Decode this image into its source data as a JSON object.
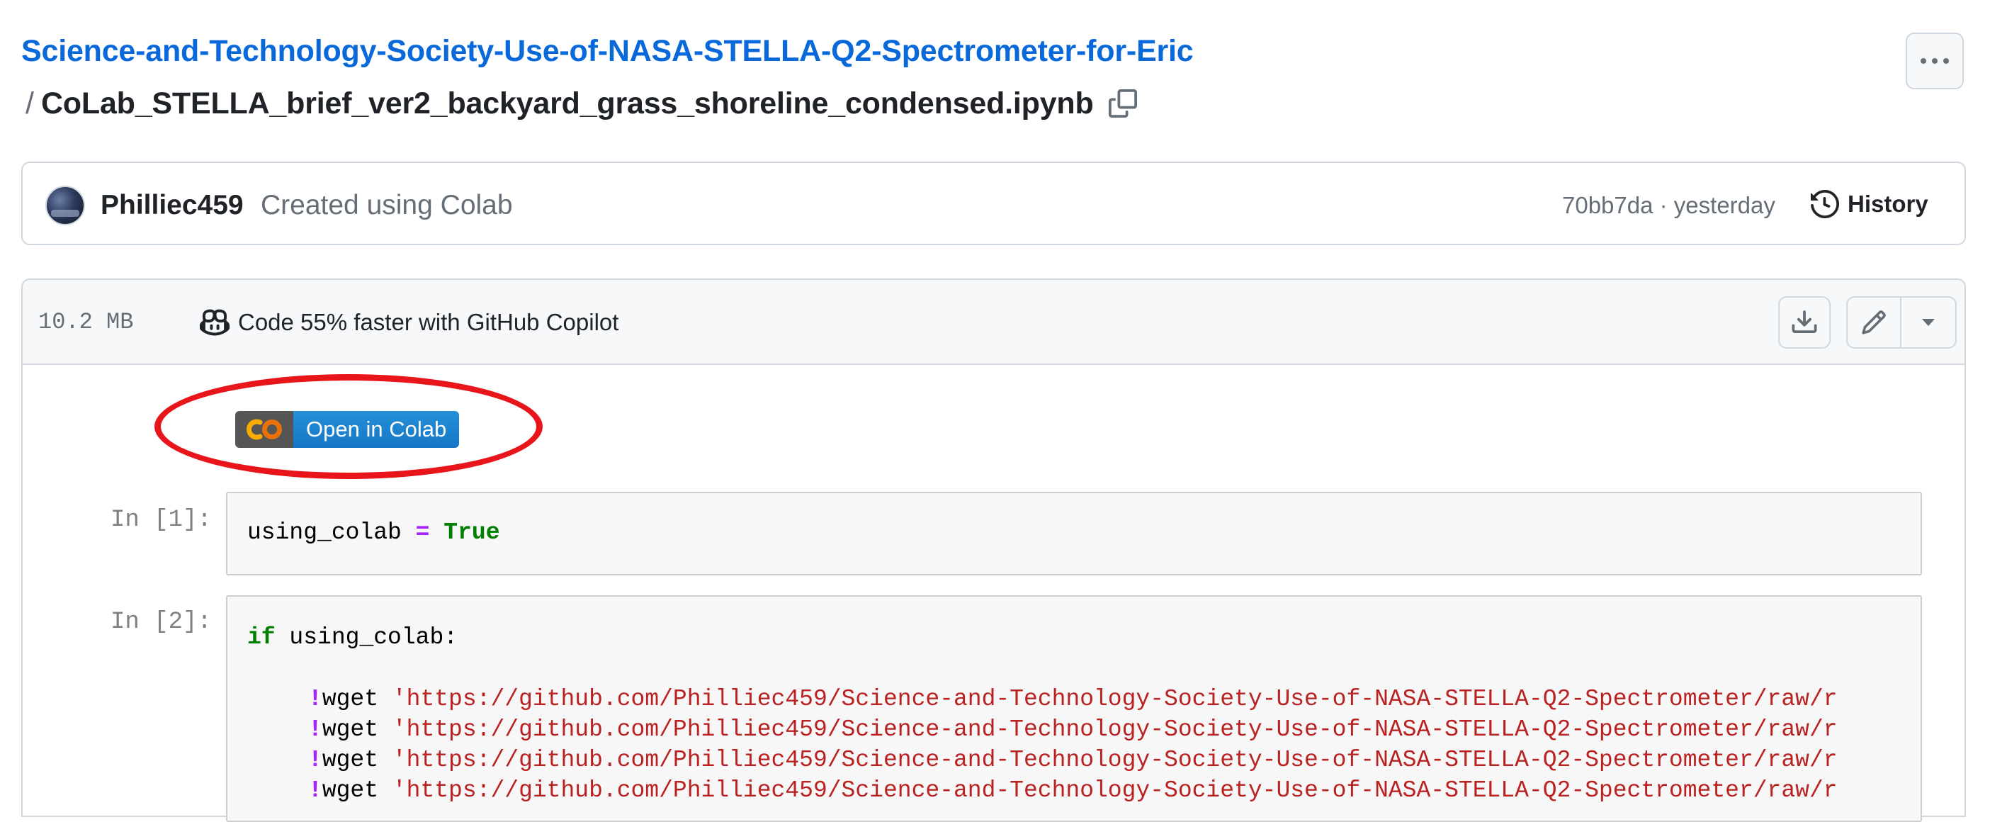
{
  "header": {
    "repo_name": "Science-and-Technology-Society-Use-of-NASA-STELLA-Q2-Spectrometer-for-Eric",
    "path_separator": "/",
    "file_name": "CoLab_STELLA_brief_ver2_backyard_grass_shoreline_condensed.ipynb"
  },
  "commit": {
    "author": "Philliec459",
    "message": "Created using Colab",
    "meta": "70bb7da · yesterday",
    "history_label": "History"
  },
  "file_header": {
    "size": "10.2 MB",
    "copilot_label": "Code 55% faster with GitHub Copilot"
  },
  "badge": {
    "label": "Open in Colab"
  },
  "cells": [
    {
      "prompt": "In [1]:",
      "code": {
        "var": "using_colab",
        "op": "=",
        "value": "True"
      }
    },
    {
      "prompt": "In [2]:",
      "code": {
        "kw": "if",
        "cond": "using_colab",
        "colon": ":",
        "bang": "!",
        "cmd": "wget",
        "url": "'https://github.com/Philliec459/Science-and-Technology-Society-Use-of-NASA-STELLA-Q2-Spectrometer/raw/r"
      }
    }
  ],
  "colors": {
    "link": "#0969da",
    "annotation": "#e8151b",
    "colab_blue": "#1576c5"
  }
}
